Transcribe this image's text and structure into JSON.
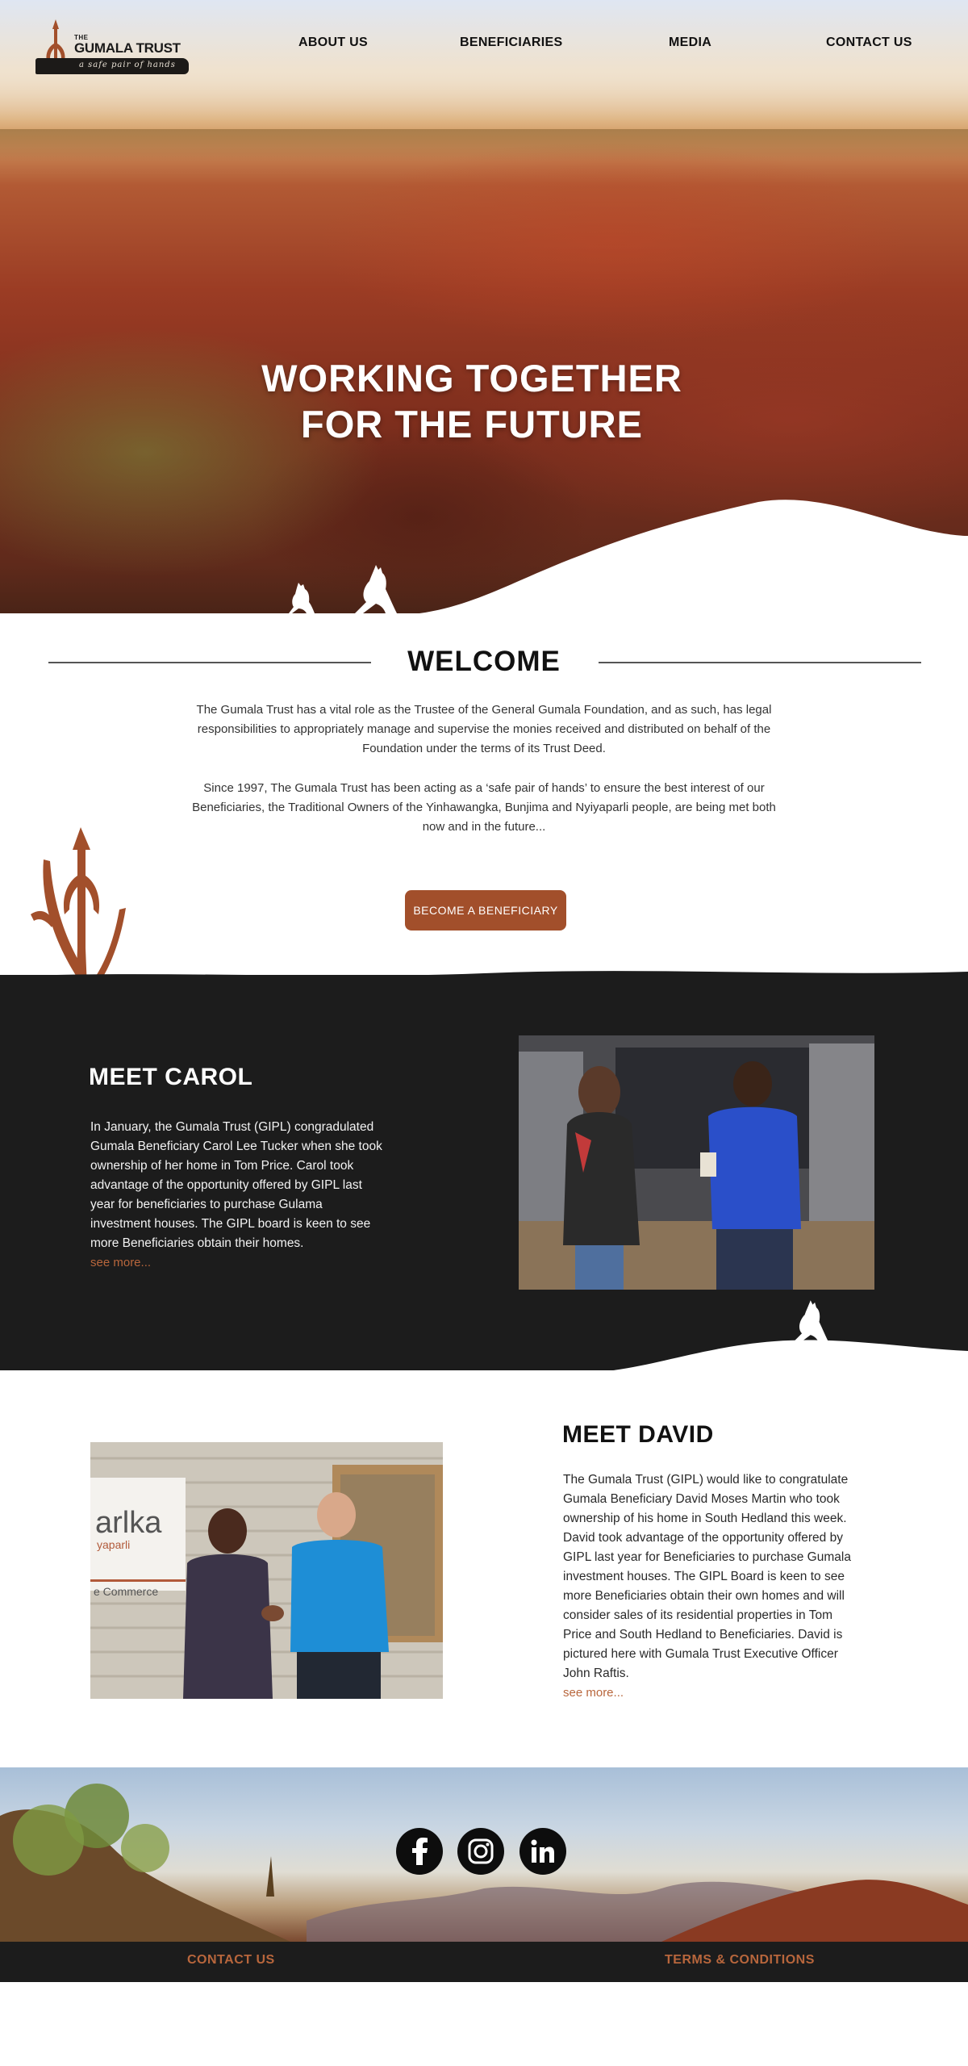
{
  "logo": {
    "the": "THE",
    "name": "GUMALA TRUST",
    "tagline": "a safe pair of hands"
  },
  "nav": {
    "items": [
      {
        "label": "ABOUT US"
      },
      {
        "label": "BENEFICIARIES"
      },
      {
        "label": "MEDIA"
      },
      {
        "label": "CONTACT US"
      }
    ]
  },
  "hero": {
    "title_line1": "WORKING TOGETHER",
    "title_line2": "FOR THE FUTURE"
  },
  "welcome": {
    "title": "WELCOME",
    "paragraph1": "The Gumala Trust has a vital role as the Trustee of the General Gumala Foundation, and as such, has legal responsibilities to appropriately manage and supervise the monies received and distributed on behalf of the Foundation under the terms of its Trust Deed.",
    "paragraph2": "Since 1997, The Gumala Trust has been acting as a ‘safe pair of hands’ to ensure the best interest of our Beneficiaries, the Traditional Owners of the Yinhawangka, Bunjima and Nyiyaparli people, are being met both now and in the future...",
    "button_label": "BECOME A BENEFICIARY"
  },
  "carol": {
    "title": "MEET CAROL",
    "body": "In January, the Gumala Trust (GIPL) congradulated Gumala Beneficiary Carol Lee Tucker when she took ownership of her home in Tom Price. Carol took advantage of the opportunity offered by GIPL last year for beneficiaries to purchase Gulama investment houses. The GIPL board is keen to see more Beneficiaries obtain their homes.",
    "see_more": "see more..."
  },
  "david": {
    "title": "MEET DAVID",
    "body": "The Gumala Trust (GIPL) would like to congratulate Gumala Beneficiary David Moses Martin who took ownership of his home in South Hedland this week. David took advantage of the opportunity offered by GIPL last year for Beneficiaries to purchase Gumala investment houses. The GIPL Board is keen to see more Beneficiaries obtain their own homes and will consider sales of its residential properties in Tom Price and South Hedland to Beneficiaries. David is pictured here with Gumala Trust Executive Officer John Raftis.",
    "see_more": "see more...",
    "photo_sign_line1": "arlka",
    "photo_sign_line2": "yaparli",
    "photo_sign_line3": "e Commerce"
  },
  "social": {
    "icons": [
      "facebook-icon",
      "instagram-icon",
      "linkedin-icon"
    ]
  },
  "footer": {
    "contact_label": "CONTACT US",
    "terms_label": "TERMS & CONDITIONS"
  },
  "colors": {
    "accent": "#a24f2b",
    "link": "#b8663c",
    "dark": "#1c1c1c"
  }
}
